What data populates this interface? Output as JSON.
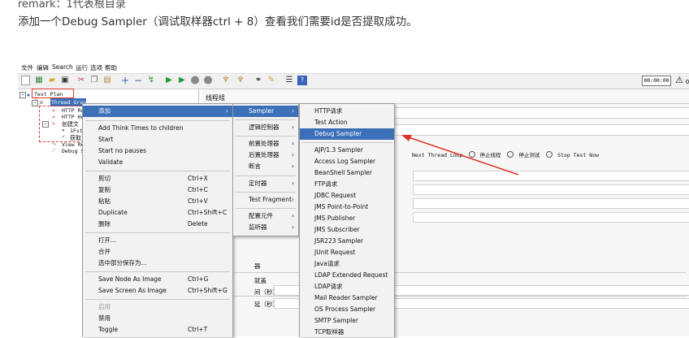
{
  "doc": {
    "remark_line": "remark：1代表根目录",
    "instruction": "添加一个Debug Sampler（调试取样器ctrl + 8）查看我们需要id是否提取成功。"
  },
  "app": {
    "menubar": [
      "文件",
      "编辑",
      "Search",
      "运行",
      "选项",
      "帮助"
    ],
    "timer": "00:00:00",
    "warning_count": "0",
    "tree": {
      "root": "Test Plan",
      "thread_group": "Thread Grou",
      "items": [
        "HTTP Re",
        "HTTP He",
        "创建文",
        "1Fst",
        "获取",
        "View Re",
        "Debug Sa"
      ]
    },
    "right_pane": {
      "title": "线程组",
      "options": [
        "Next Thread Loop",
        "停止线程",
        "停止测试",
        "Stop Test Now"
      ],
      "fragments": [
        "器",
        "就盖",
        "间（秒）",
        "延（秒）"
      ]
    }
  },
  "context_menu": {
    "items": [
      {
        "label": "添加",
        "shortcut": "",
        "submenu": true,
        "highlighted": true
      },
      {
        "label": "Add Think Times to children",
        "shortcut": ""
      },
      {
        "label": "Start",
        "shortcut": ""
      },
      {
        "label": "Start no pauses",
        "shortcut": ""
      },
      {
        "label": "Validate",
        "shortcut": ""
      },
      {
        "label": "剪切",
        "shortcut": "Ctrl+X"
      },
      {
        "label": "复制",
        "shortcut": "Ctrl+C"
      },
      {
        "label": "粘贴",
        "shortcut": "Ctrl+V"
      },
      {
        "label": "Duplicate",
        "shortcut": "Ctrl+Shift+C"
      },
      {
        "label": "删除",
        "shortcut": "Delete"
      },
      {
        "label": "打开...",
        "shortcut": ""
      },
      {
        "label": "合并",
        "shortcut": ""
      },
      {
        "label": "选中部分保存为...",
        "shortcut": ""
      },
      {
        "label": "Save Node As Image",
        "shortcut": "Ctrl+G"
      },
      {
        "label": "Save Screen As Image",
        "shortcut": "Ctrl+Shift+G"
      },
      {
        "label": "启用",
        "shortcut": "",
        "disabled": true
      },
      {
        "label": "禁用",
        "shortcut": ""
      },
      {
        "label": "Toggle",
        "shortcut": "Ctrl+T"
      }
    ]
  },
  "add_submenu": {
    "items": [
      "Sampler",
      "逻辑控制器",
      "前置处理器",
      "后置处理器",
      "断言",
      "定时器",
      "Test Fragment",
      "配置元件",
      "监听器"
    ]
  },
  "sampler_submenu": {
    "items": [
      "HTTP请求",
      "Test Action",
      "Debug Sampler",
      "AJP/1.3 Sampler",
      "Access Log Sampler",
      "BeanShell Sampler",
      "FTP请求",
      "JDBC Request",
      "JMS Point-to-Point",
      "JMS Publisher",
      "JMS Subscriber",
      "JSR223 Sampler",
      "JUnit Request",
      "Java请求",
      "LDAP Extended Request",
      "LDAP请求",
      "Mail Reader Sampler",
      "OS Process Sampler",
      "SMTP Sampler",
      "TCP取样器"
    ],
    "highlighted_index": 2
  },
  "colors": {
    "highlight": "#3b6fb8",
    "annotation": "#e0322a",
    "menu_bg": "#f2f2f2"
  }
}
